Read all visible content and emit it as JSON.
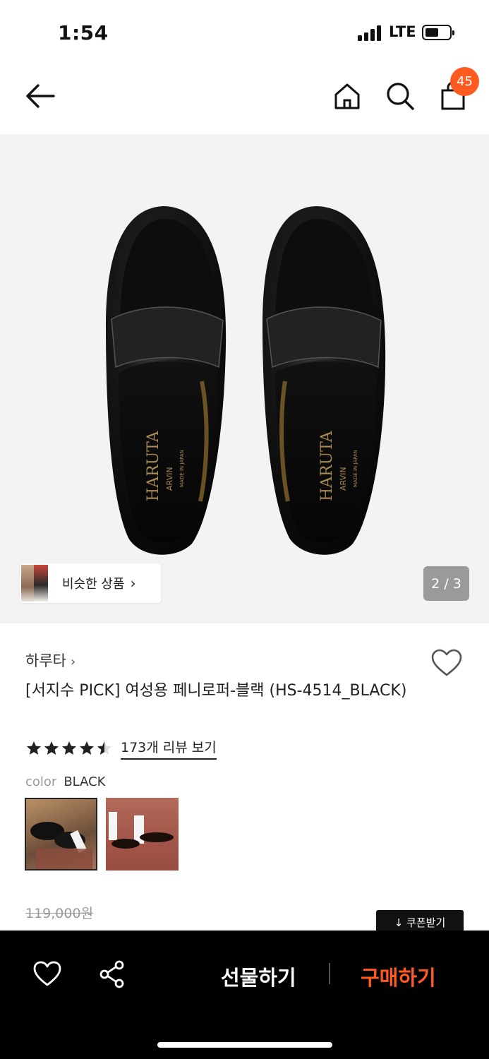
{
  "status_bar": {
    "time": "1:54",
    "network": "LTE"
  },
  "nav": {
    "cart_count": "45"
  },
  "gallery": {
    "similar_label": "비슷한 상품",
    "page_indicator": "2 / 3",
    "shoe_insole_brand": "HARUTA",
    "shoe_insole_sub": "ARVIN",
    "shoe_insole_note": "MADE IN JAPAN"
  },
  "product": {
    "brand": "하루타",
    "title": "[서지수 PICK] 여성용 페니로퍼-블랙 (HS-4514_BLACK)",
    "rating": 4.5,
    "review_link": "173개 리뷰 보기",
    "color_label": "color",
    "color_value": "BLACK",
    "original_price": "119,000원",
    "coupon_label": "↓ 쿠폰받기"
  },
  "bottom_bar": {
    "gift_label": "선물하기",
    "buy_label": "구매하기",
    "accent_color": "#ff5a1f"
  }
}
